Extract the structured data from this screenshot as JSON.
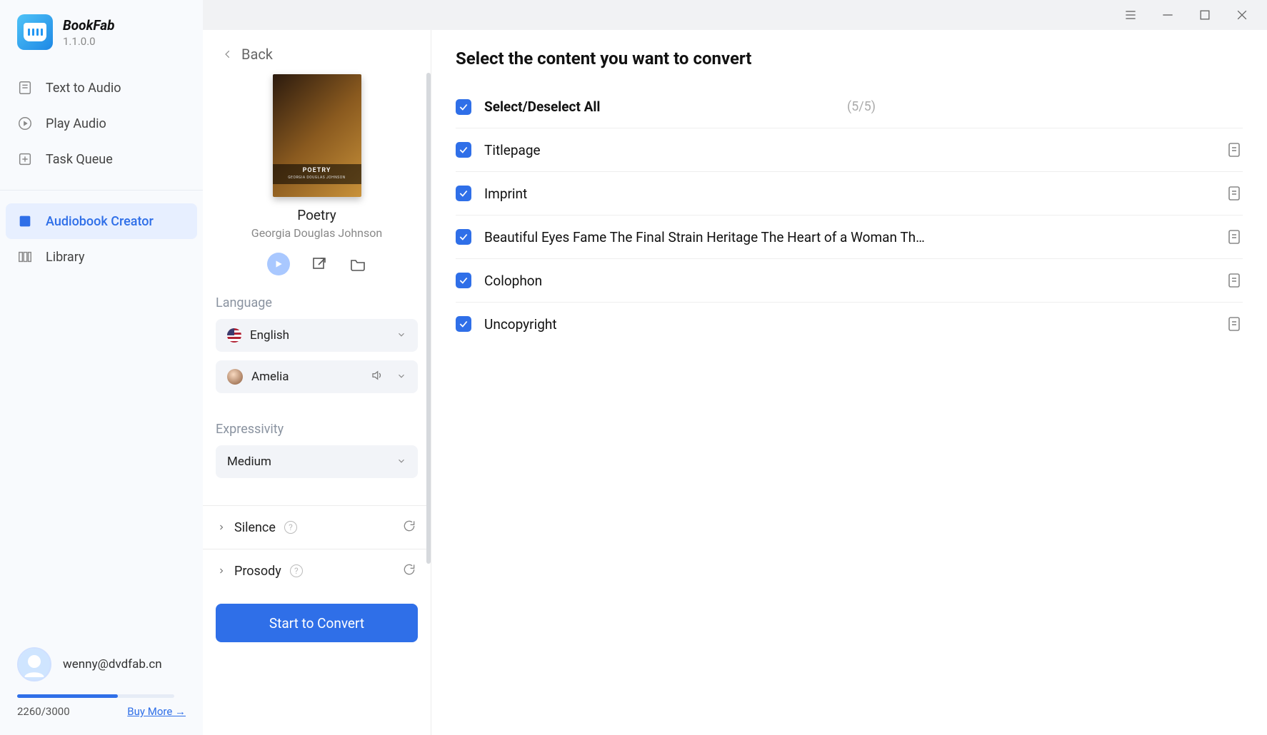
{
  "app": {
    "name": "BookFab",
    "version": "1.1.0.0"
  },
  "sidebar": {
    "items": [
      {
        "label": "Text to Audio"
      },
      {
        "label": "Play Audio"
      },
      {
        "label": "Task Queue"
      },
      {
        "label": "Audiobook Creator"
      },
      {
        "label": "Library"
      }
    ]
  },
  "user": {
    "email": "wenny@dvdfab.cn",
    "usage": "2260/3000",
    "buy_more": "Buy More →"
  },
  "back_label": "Back",
  "book": {
    "cover_text": "POETRY",
    "cover_sub": "GEORGIA DOUGLAS JOHNSON",
    "title": "Poetry",
    "author": "Georgia Douglas Johnson"
  },
  "settings": {
    "language_label": "Language",
    "language_value": "English",
    "voice_value": "Amelia",
    "expressivity_label": "Expressivity",
    "expressivity_value": "Medium",
    "silence_label": "Silence",
    "prosody_label": "Prosody",
    "convert_label": "Start to Convert"
  },
  "content": {
    "title": "Select the content you want to convert",
    "select_all_label": "Select/Deselect All",
    "count": "(5/5)",
    "items": [
      {
        "label": "Titlepage"
      },
      {
        "label": "Imprint"
      },
      {
        "label": "Beautiful Eyes Fame The Final Strain Heritage The Heart of a Woman Th…"
      },
      {
        "label": "Colophon"
      },
      {
        "label": "Uncopyright"
      }
    ]
  }
}
